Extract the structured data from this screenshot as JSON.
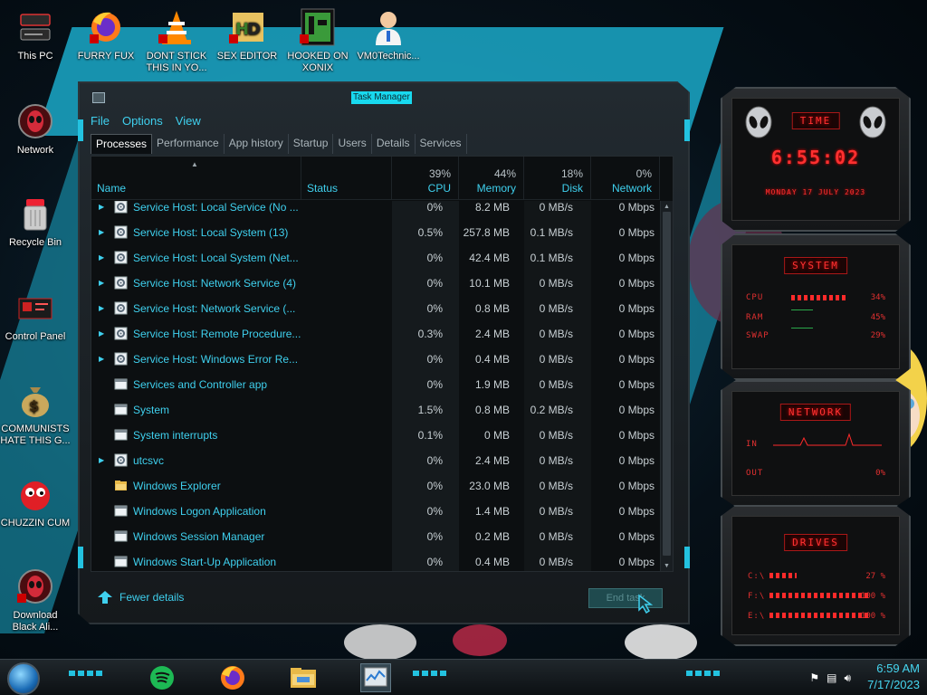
{
  "desktop": {
    "icons": [
      {
        "label": "This PC",
        "icon": "computer-icon"
      },
      {
        "label": "FURRY FUX",
        "icon": "firefox-icon"
      },
      {
        "label": "DONT STICK THIS IN YO...",
        "icon": "vlc-cone-icon"
      },
      {
        "label": "SEX EDITOR",
        "icon": "hxd-hex-editor-icon"
      },
      {
        "label": "HOOKED ON XONIX",
        "icon": "xonix-game-icon"
      },
      {
        "label": "VM0Technic...",
        "icon": "doctor-icon"
      },
      {
        "label": "Network",
        "icon": "alien-network-icon"
      },
      {
        "label": "Recycle Bin",
        "icon": "recycle-bin-icon"
      },
      {
        "label": "Control Panel",
        "icon": "control-panel-icon"
      },
      {
        "label": "COMMUNISTS HATE THIS G...",
        "icon": "money-bag-icon"
      },
      {
        "label": "CHUZZIN CUM",
        "icon": "chuzzle-icon"
      },
      {
        "label": "Download Black Ali...",
        "icon": "alien-download-icon"
      }
    ]
  },
  "window": {
    "title": "Task Manager",
    "menu": [
      "File",
      "Options",
      "View"
    ],
    "tabs": [
      "Processes",
      "Performance",
      "App history",
      "Startup",
      "Users",
      "Details",
      "Services"
    ],
    "active_tab": "Processes",
    "columns": {
      "name": "Name",
      "status": "Status",
      "cpu": {
        "label": "CPU",
        "pct": "39%"
      },
      "memory": {
        "label": "Memory",
        "pct": "44%"
      },
      "disk": {
        "label": "Disk",
        "pct": "18%"
      },
      "network": {
        "label": "Network",
        "pct": "0%"
      }
    },
    "rows": [
      {
        "name": "Service Host: Local Service (No ...",
        "cpu": "0%",
        "mem": "8.2 MB",
        "disk": "0 MB/s",
        "net": "0 Mbps",
        "expandable": true,
        "icon": "gear-icon"
      },
      {
        "name": "Service Host: Local System (13)",
        "cpu": "0.5%",
        "mem": "257.8 MB",
        "disk": "0.1 MB/s",
        "net": "0 Mbps",
        "expandable": true,
        "icon": "gear-icon"
      },
      {
        "name": "Service Host: Local System (Net...",
        "cpu": "0%",
        "mem": "42.4 MB",
        "disk": "0.1 MB/s",
        "net": "0 Mbps",
        "expandable": true,
        "icon": "gear-icon"
      },
      {
        "name": "Service Host: Network Service (4)",
        "cpu": "0%",
        "mem": "10.1 MB",
        "disk": "0 MB/s",
        "net": "0 Mbps",
        "expandable": true,
        "icon": "gear-icon"
      },
      {
        "name": "Service Host: Network Service (...",
        "cpu": "0%",
        "mem": "0.8 MB",
        "disk": "0 MB/s",
        "net": "0 Mbps",
        "expandable": true,
        "icon": "gear-icon"
      },
      {
        "name": "Service Host: Remote Procedure...",
        "cpu": "0.3%",
        "mem": "2.4 MB",
        "disk": "0 MB/s",
        "net": "0 Mbps",
        "expandable": true,
        "icon": "gear-icon"
      },
      {
        "name": "Service Host: Windows Error Re...",
        "cpu": "0%",
        "mem": "0.4 MB",
        "disk": "0 MB/s",
        "net": "0 Mbps",
        "expandable": true,
        "icon": "gear-icon"
      },
      {
        "name": "Services and Controller app",
        "cpu": "0%",
        "mem": "1.9 MB",
        "disk": "0 MB/s",
        "net": "0 Mbps",
        "expandable": false,
        "icon": "app-window-icon"
      },
      {
        "name": "System",
        "cpu": "1.5%",
        "mem": "0.8 MB",
        "disk": "0.2 MB/s",
        "net": "0 Mbps",
        "expandable": false,
        "icon": "app-window-icon"
      },
      {
        "name": "System interrupts",
        "cpu": "0.1%",
        "mem": "0 MB",
        "disk": "0 MB/s",
        "net": "0 Mbps",
        "expandable": false,
        "icon": "app-window-icon"
      },
      {
        "name": "utcsvc",
        "cpu": "0%",
        "mem": "2.4 MB",
        "disk": "0 MB/s",
        "net": "0 Mbps",
        "expandable": true,
        "icon": "gear-icon"
      },
      {
        "name": "Windows Explorer",
        "cpu": "0%",
        "mem": "23.0 MB",
        "disk": "0 MB/s",
        "net": "0 Mbps",
        "expandable": false,
        "icon": "folder-icon"
      },
      {
        "name": "Windows Logon Application",
        "cpu": "0%",
        "mem": "1.4 MB",
        "disk": "0 MB/s",
        "net": "0 Mbps",
        "expandable": false,
        "icon": "app-window-icon"
      },
      {
        "name": "Windows Session Manager",
        "cpu": "0%",
        "mem": "0.2 MB",
        "disk": "0 MB/s",
        "net": "0 Mbps",
        "expandable": false,
        "icon": "app-window-icon"
      },
      {
        "name": "Windows Start-Up Application",
        "cpu": "0%",
        "mem": "0.4 MB",
        "disk": "0 MB/s",
        "net": "0 Mbps",
        "expandable": false,
        "icon": "app-window-icon"
      }
    ],
    "footer": {
      "fewer_details": "Fewer details",
      "end_task": "End task"
    }
  },
  "widgets": {
    "time": {
      "title": "TIME",
      "clock": "6:55:02",
      "date": "MONDAY 17 JULY 2023"
    },
    "system": {
      "title": "SYSTEM",
      "cpu_label": "CPU",
      "cpu_val": "34%",
      "ram_label": "RAM",
      "ram_val": "45%",
      "swap_label": "SWAP",
      "swap_val": "29%"
    },
    "network": {
      "title": "NETWORK",
      "in_label": "IN",
      "out_label": "OUT",
      "out_val": "0%"
    },
    "drives": {
      "title": "DRIVES",
      "items": [
        {
          "label": "C:\\",
          "val": "27 %"
        },
        {
          "label": "F:\\",
          "val": "100 %"
        },
        {
          "label": "E:\\",
          "val": "100 %"
        }
      ]
    }
  },
  "taskbar": {
    "apps": [
      "spotify-icon",
      "firefox-icon",
      "file-explorer-icon",
      "task-manager-icon"
    ],
    "active_app": "task-manager-icon",
    "clock_time": "6:59 AM",
    "clock_date": "7/17/2023"
  },
  "colors": {
    "accent": "#3fd0ee",
    "widget_red": "#ff3030",
    "title_highlight": "#18d9ef"
  }
}
